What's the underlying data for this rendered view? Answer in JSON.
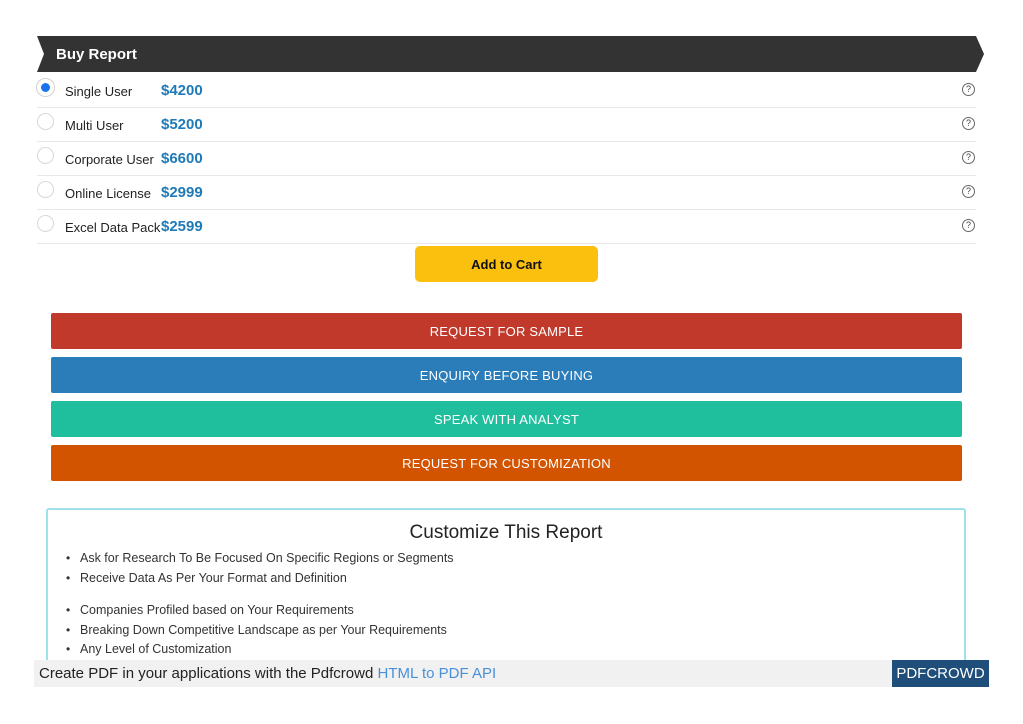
{
  "header": {
    "title": "Buy Report"
  },
  "licenses": [
    {
      "name": "Single User",
      "price": "$4200",
      "selected": true,
      "help": "?"
    },
    {
      "name": "Multi User",
      "price": "$5200",
      "selected": false,
      "help": "?"
    },
    {
      "name": "Corporate User",
      "price": "$6600",
      "selected": false,
      "help": "?"
    },
    {
      "name": "Online License",
      "price": "$2999",
      "selected": false,
      "help": "?"
    },
    {
      "name": "Excel Data Pack",
      "price": "$2599",
      "selected": false,
      "help": "?"
    }
  ],
  "cart": {
    "label": "Add to Cart"
  },
  "actions": [
    {
      "label": "REQUEST FOR SAMPLE",
      "color": "#c0392b"
    },
    {
      "label": "ENQUIRY BEFORE BUYING",
      "color": "#2b7dba"
    },
    {
      "label": "SPEAK WITH ANALYST",
      "color": "#1fbf9e"
    },
    {
      "label": "REQUEST FOR CUSTOMIZATION",
      "color": "#d35400"
    }
  ],
  "customize": {
    "title": "Customize This Report",
    "group1": [
      "Ask for Research To Be Focused On Specific Regions or Segments",
      "Receive Data As Per Your Format and Definition"
    ],
    "group2": [
      "Companies Profiled based on Your Requirements",
      "Breaking Down Competitive Landscape as per Your Requirements",
      "Any Level of Customization"
    ]
  },
  "footer": {
    "text": "Create PDF in your applications with the Pdfcrowd ",
    "link": "HTML to PDF API",
    "badge": "PDFCROWD"
  },
  "colors": {
    "header_bg": "#333333",
    "price": "#1f7ab8",
    "cart": "#fbbf0e",
    "badge": "#1f4e7a"
  }
}
